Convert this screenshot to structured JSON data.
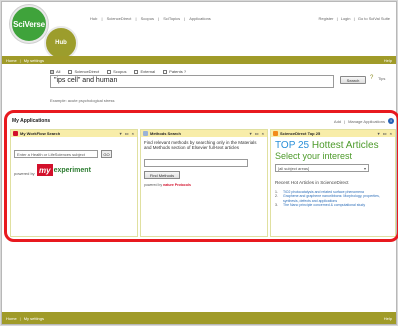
{
  "header": {
    "logo_text": "SciVerse",
    "hub_text": "Hub",
    "nav_links": [
      "Hub",
      "ScienceDirect",
      "Scopus",
      "SciTopics",
      "Applications"
    ],
    "nav_separator": "|",
    "user_links": [
      "Register",
      "Login",
      "Go to SciVal Suite"
    ]
  },
  "nav_bar": {
    "home": "Home",
    "settings": "My settings",
    "help": "Help"
  },
  "search": {
    "sources": [
      {
        "label": "All",
        "checked": true
      },
      {
        "label": "ScienceDirect",
        "checked": false
      },
      {
        "label": "Scopus",
        "checked": false
      },
      {
        "label": "External",
        "checked": false
      },
      {
        "label": "Patents",
        "checked": false
      }
    ],
    "sources_suffix": "?",
    "query": "\"ips cell\" and human",
    "button": "Search",
    "help_symbol": "?",
    "tips": "Tips",
    "example": "Example: acute psychological stress"
  },
  "applications": {
    "title": "My Applications",
    "add_link": "Add",
    "manage_link": "Manage Applications",
    "info_symbol": "i",
    "controls": "▾ ▭ ×",
    "gadgets": [
      {
        "title": "My WorkFlow Search",
        "input_placeholder": "Enter a Health or LifeSciences subject",
        "go": "GO",
        "powered_by": "powered by",
        "logo_my": "my",
        "logo_word": "experiment"
      },
      {
        "title": "Methods Search",
        "description": "Find relevant methods by searching only in the Materials and Methods section of Elsevier full-text articles",
        "button": "Find Methods",
        "powered_by": "powered by",
        "powered_brand": "nature Protocols"
      },
      {
        "title": "ScienceDirect Top 25",
        "headline_a": "TOP 25",
        "headline_b": "Hottest Articles",
        "subheadline": "Select your interest",
        "select_value": "[all subject areas]",
        "recent_heading": "Recent Hot Articles in ScienceDirect",
        "articles": [
          {
            "num": "1.",
            "text": "TiO2 photocatalysis and related surface phenomena"
          },
          {
            "num": "2.",
            "text": "Graphene and graphene nanoribbons: Morphology, properties, synthesis, defects and applications"
          },
          {
            "num": "3.",
            "text": "The Nano principle concerned & computational study"
          }
        ]
      }
    ]
  },
  "footer": {
    "home": "Home",
    "settings": "My settings",
    "help": "Help"
  },
  "colors": {
    "olive": "#a09b29",
    "highlight_outline": "#e8191f",
    "gadget_header": "#f8eda9",
    "top25_blue": "#2a8fd8",
    "top25_green": "#4c9a2a"
  }
}
